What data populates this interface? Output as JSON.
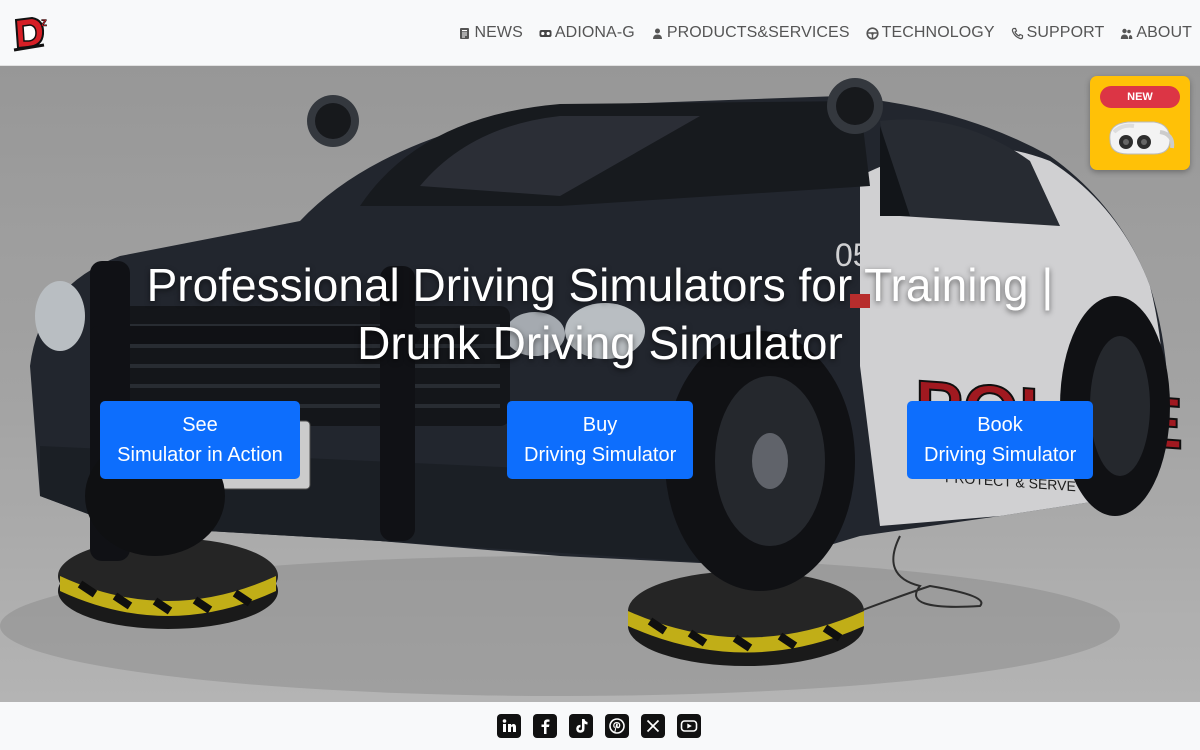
{
  "header": {
    "logo_alt": "DZ",
    "nav": [
      {
        "label": "NEWS",
        "icon": "newspaper-icon"
      },
      {
        "label": "ADIONA-G",
        "icon": "vr-headset-icon"
      },
      {
        "label": "PRODUCTS&SERVICES",
        "icon": "person-icon"
      },
      {
        "label": "TECHNOLOGY",
        "icon": "steering-wheel-icon"
      },
      {
        "label": "SUPPORT",
        "icon": "phone-icon"
      },
      {
        "label": "ABOUT",
        "icon": "people-icon"
      }
    ]
  },
  "hero": {
    "title_line1": "Professional Driving Simulators for Training |",
    "title_line2": "Drunk Driving Simulator",
    "buttons": [
      {
        "line1": "See",
        "line2": "Simulator in Action"
      },
      {
        "line1": "Buy",
        "line2": "Driving Simulator"
      },
      {
        "line1": "Book",
        "line2": "Driving Simulator"
      }
    ],
    "badge": {
      "label": "NEW"
    },
    "car_number": "055",
    "car_text": "POLICE",
    "car_motto": "PROTECT & SERVE"
  },
  "footer": {
    "social": [
      "linkedin-icon",
      "facebook-icon",
      "tiktok-icon",
      "pinterest-icon",
      "x-icon",
      "youtube-icon"
    ]
  },
  "colors": {
    "primary": "#0d6efd",
    "badge_bg": "#ffc107",
    "badge_pill": "#dc3545",
    "header_bg": "#f8f9fa"
  }
}
